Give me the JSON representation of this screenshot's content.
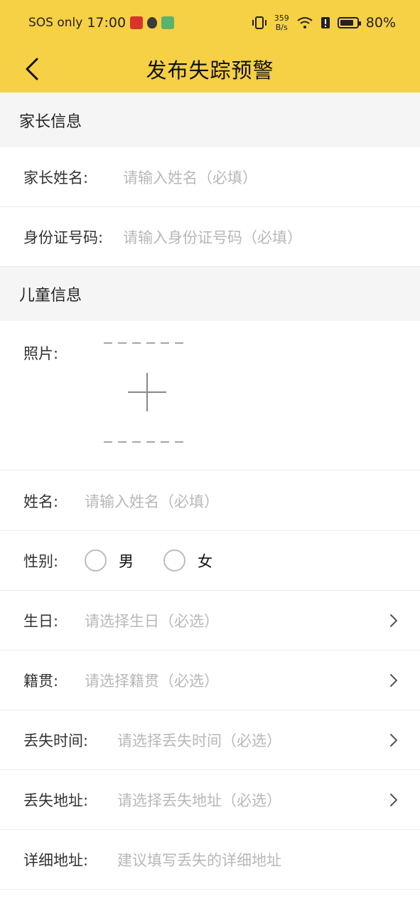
{
  "status_bar": {
    "carrier": "SOS only",
    "time": "17:00",
    "net_speed_value": "359",
    "net_speed_unit": "B/s",
    "battery": "80%"
  },
  "header": {
    "title": "发布失踪预警"
  },
  "parent_section": {
    "title": "家长信息",
    "name_label": "家长姓名:",
    "name_placeholder": "请输入姓名（必填）",
    "id_label": "身份证号码:",
    "id_placeholder": "请输入身份证号码（必填）"
  },
  "child_section": {
    "title": "儿童信息",
    "photo_label": "照片:",
    "name_label": "姓名:",
    "name_placeholder": "请输入姓名（必填）",
    "gender_label": "性别:",
    "gender_options": [
      "男",
      "女"
    ],
    "birthday_label": "生日:",
    "birthday_placeholder": "请选择生日（必选）",
    "hometown_label": "籍贯:",
    "hometown_placeholder": "请选择籍贯（必选）",
    "lost_time_label": "丢失时间:",
    "lost_time_placeholder": "请选择丢失时间（必选）",
    "lost_address_label": "丢失地址:",
    "lost_address_placeholder": "请选择丢失地址（必选）",
    "detail_address_label": "详细地址:",
    "detail_address_placeholder": "建议填写丢失的详细地址"
  },
  "colors": {
    "header_bg": "#f6d045",
    "section_bg": "#f5f5f5",
    "placeholder": "#b8b8b8"
  }
}
